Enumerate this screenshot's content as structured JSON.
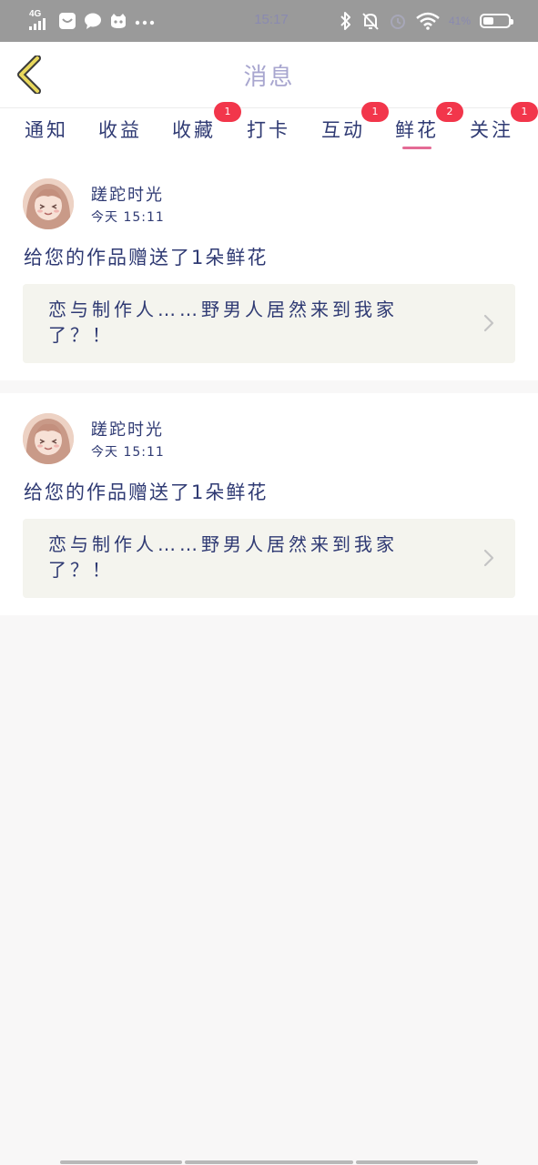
{
  "status_bar": {
    "network": "4G",
    "time": "15:17",
    "battery_percent": "41%",
    "battery_level": 0.41,
    "icons_left": [
      "signal-icon",
      "app-notification-icon",
      "chat-icon",
      "cat-app-icon",
      "more-dots-icon"
    ],
    "icons_right": [
      "bluetooth-icon",
      "mute-bell-icon",
      "alarm-icon",
      "wifi-icon",
      "battery-icon"
    ]
  },
  "header": {
    "title": "消息",
    "back_icon": "chevron-left-icon"
  },
  "tabs": [
    {
      "label": "通知",
      "badge": "",
      "active": false
    },
    {
      "label": "收益",
      "badge": "",
      "active": false
    },
    {
      "label": "收藏",
      "badge": "1",
      "active": false
    },
    {
      "label": "打卡",
      "badge": "",
      "active": false
    },
    {
      "label": "互动",
      "badge": "1",
      "active": false
    },
    {
      "label": "鲜花",
      "badge": "2",
      "active": true
    },
    {
      "label": "关注",
      "badge": "1",
      "active": false
    }
  ],
  "messages": [
    {
      "username": "蹉跎时光",
      "timestamp": "今天 15:11",
      "text": "给您的作品赠送了1朵鲜花",
      "work_title": "恋与制作人……野男人居然来到我家了？！"
    },
    {
      "username": "蹉跎时光",
      "timestamp": "今天 15:11",
      "text": "给您的作品赠送了1朵鲜花",
      "work_title": "恋与制作人……野男人居然来到我家了？！"
    }
  ],
  "colors": {
    "status_bar": "#9a9a9a",
    "text": "#2f3a73",
    "title": "#a8a6cf",
    "badge": "#f2364b",
    "active_underline": "#e46b95",
    "link_bg": "#f4f4ee",
    "page_bg": "#f8f7f7"
  }
}
